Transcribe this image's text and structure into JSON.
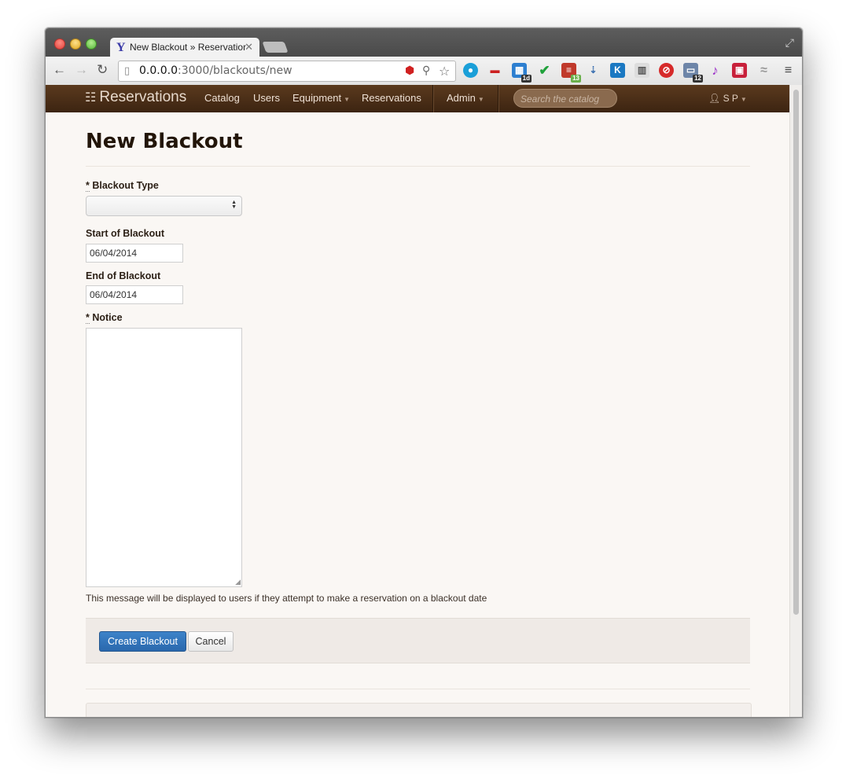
{
  "browser": {
    "tab_title": "New Blackout » Reservation",
    "tab_favicon": "Y",
    "url_host": "0.0.0.0",
    "url_path": ":3000/blackouts/new",
    "extension_badges": [
      "1d",
      "13",
      "12"
    ]
  },
  "navbar": {
    "brand": "Reservations",
    "items": {
      "catalog": "Catalog",
      "users": "Users",
      "equipment": "Equipment",
      "reservations": "Reservations",
      "admin": "Admin"
    },
    "search_placeholder": "Search the catalog",
    "user": "S P"
  },
  "page": {
    "title": "New Blackout",
    "blackout_type_label": "Blackout Type",
    "start_label": "Start of Blackout",
    "start_value": "06/04/2014",
    "end_label": "End of Blackout",
    "end_value": "06/04/2014",
    "notice_label": "Notice",
    "notice_help": "This message will be displayed to users if they attempt to make a reservation on a blackout date",
    "required_marker": "*",
    "submit": "Create Blackout",
    "cancel": "Cancel"
  },
  "colors": {
    "navbar": "#4a2e17",
    "primary_button": "#3474b8",
    "page_background": "#faf7f4"
  }
}
